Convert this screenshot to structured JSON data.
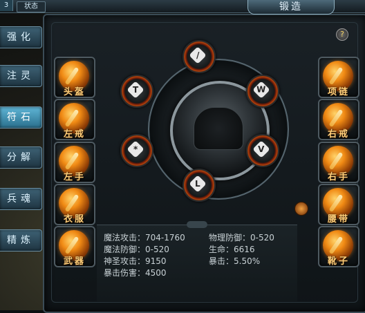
{
  "header": {
    "level_badge": "3",
    "status_tab": "状态",
    "title": "锻造"
  },
  "side_menu": [
    {
      "label": "强化",
      "active": false
    },
    {
      "label": "注灵",
      "active": false
    },
    {
      "label": "符石",
      "active": true
    },
    {
      "label": "分解",
      "active": false
    },
    {
      "label": "兵魂",
      "active": false
    },
    {
      "label": "精炼",
      "active": false
    }
  ],
  "help": {
    "label": "?"
  },
  "slots_left": [
    {
      "label": "头盔"
    },
    {
      "label": "左戒"
    },
    {
      "label": "左手"
    },
    {
      "label": "衣服"
    },
    {
      "label": "武器"
    }
  ],
  "slots_right": [
    {
      "label": "项链"
    },
    {
      "label": "右戒"
    },
    {
      "label": "右手"
    },
    {
      "label": "腰带"
    },
    {
      "label": "靴子"
    }
  ],
  "rune_gems": [
    {
      "icon": "rune-sword-icon",
      "glyph": "/"
    },
    {
      "icon": "rune-axe-icon",
      "glyph": "T"
    },
    {
      "icon": "rune-wing-icon",
      "glyph": "W"
    },
    {
      "icon": "rune-star-icon",
      "glyph": "*"
    },
    {
      "icon": "rune-shield-icon",
      "glyph": "V"
    },
    {
      "icon": "rune-boot-icon",
      "glyph": "L"
    }
  ],
  "stats": {
    "magic_attack": {
      "label": "魔法攻击：",
      "value": "704-1760"
    },
    "physical_defense": {
      "label": "物理防御：",
      "value": "0-520"
    },
    "magic_defense": {
      "label": "魔法防御：",
      "value": "0-520"
    },
    "hp": {
      "label": "生命：",
      "value": "6616"
    },
    "holy_attack": {
      "label": "神圣攻击：",
      "value": "9150"
    },
    "crit": {
      "label": "暴击：",
      "value": "5.50%"
    },
    "crit_damage": {
      "label": "暴击伤害：",
      "value": "4500"
    }
  },
  "colors": {
    "accent": "#f08a14",
    "menu_active": "#5fb5d6",
    "label_gold": "#ffcf7a"
  }
}
